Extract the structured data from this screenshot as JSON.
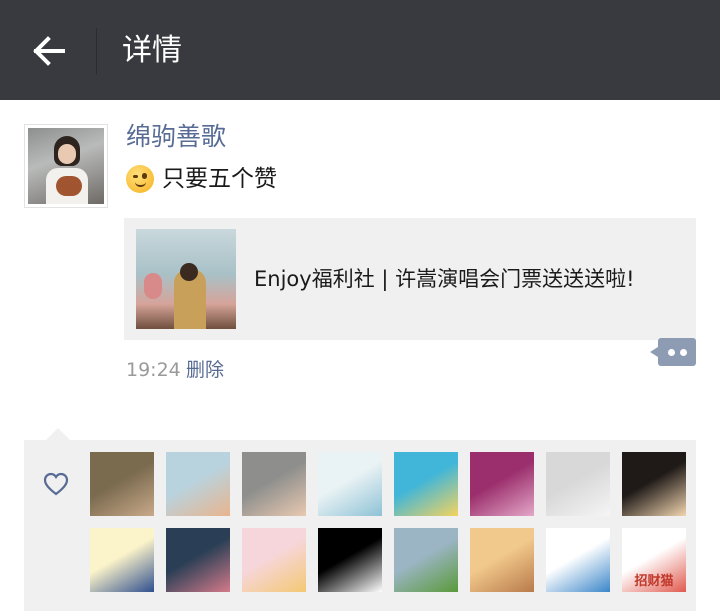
{
  "header": {
    "title": "详情",
    "back_icon": "arrow-left-icon"
  },
  "post": {
    "author": "绵驹善歌",
    "text": "只要五个赞",
    "emoji": "wink-face-icon",
    "link": {
      "title": "Enjoy福利社 | 许嵩演唱会门票送送送啦!"
    },
    "time": "19:24",
    "delete_label": "删除",
    "comment_icon": "comment-dots-icon"
  },
  "likes": {
    "heart_icon": "heart-outline-icon",
    "avatars": [
      {
        "name": "like-avatar-woman",
        "colors": [
          "#7a6a4e",
          "#c9a98a"
        ]
      },
      {
        "name": "like-avatar-girl-profile",
        "colors": [
          "#b9d3de",
          "#e8b48e"
        ]
      },
      {
        "name": "like-avatar-girl-with-bear",
        "colors": [
          "#8e8f8d",
          "#e9c9b1"
        ]
      },
      {
        "name": "like-avatar-flowers",
        "colors": [
          "#e9f2f4",
          "#8ec2d6"
        ]
      },
      {
        "name": "like-avatar-cartoon-boy-headphones",
        "colors": [
          "#41b6d8",
          "#f4d35e"
        ]
      },
      {
        "name": "like-avatar-guitar-player",
        "colors": [
          "#9b2f6d",
          "#e4a8c8"
        ]
      },
      {
        "name": "like-avatar-white-cat",
        "colors": [
          "#d8d8d8",
          "#f5f5f5"
        ]
      },
      {
        "name": "like-avatar-silhouette",
        "colors": [
          "#1f1a18",
          "#f2d6b0"
        ]
      },
      {
        "name": "like-avatar-cartoon-kid",
        "colors": [
          "#fbf3c9",
          "#2f4f8f"
        ]
      },
      {
        "name": "like-avatar-pink-sky",
        "colors": [
          "#2a3f55",
          "#d47a8a"
        ]
      },
      {
        "name": "like-avatar-cute-faces",
        "colors": [
          "#f6d6da",
          "#f4c873"
        ]
      },
      {
        "name": "like-avatar-swoosh-logo",
        "colors": [
          "#000000",
          "#ffffff"
        ]
      },
      {
        "name": "like-avatar-green-leaf",
        "colors": [
          "#9bb5c4",
          "#5a9a3a"
        ]
      },
      {
        "name": "like-avatar-sunset-girl",
        "colors": [
          "#f2c98c",
          "#b87a4b"
        ]
      },
      {
        "name": "like-avatar-cartoon-fish",
        "colors": [
          "#ffffff",
          "#3b86c9"
        ]
      },
      {
        "name": "like-avatar-lucky-cat",
        "colors": [
          "#ffffff",
          "#e05a4f"
        ],
        "text": "招财猫"
      }
    ]
  }
}
